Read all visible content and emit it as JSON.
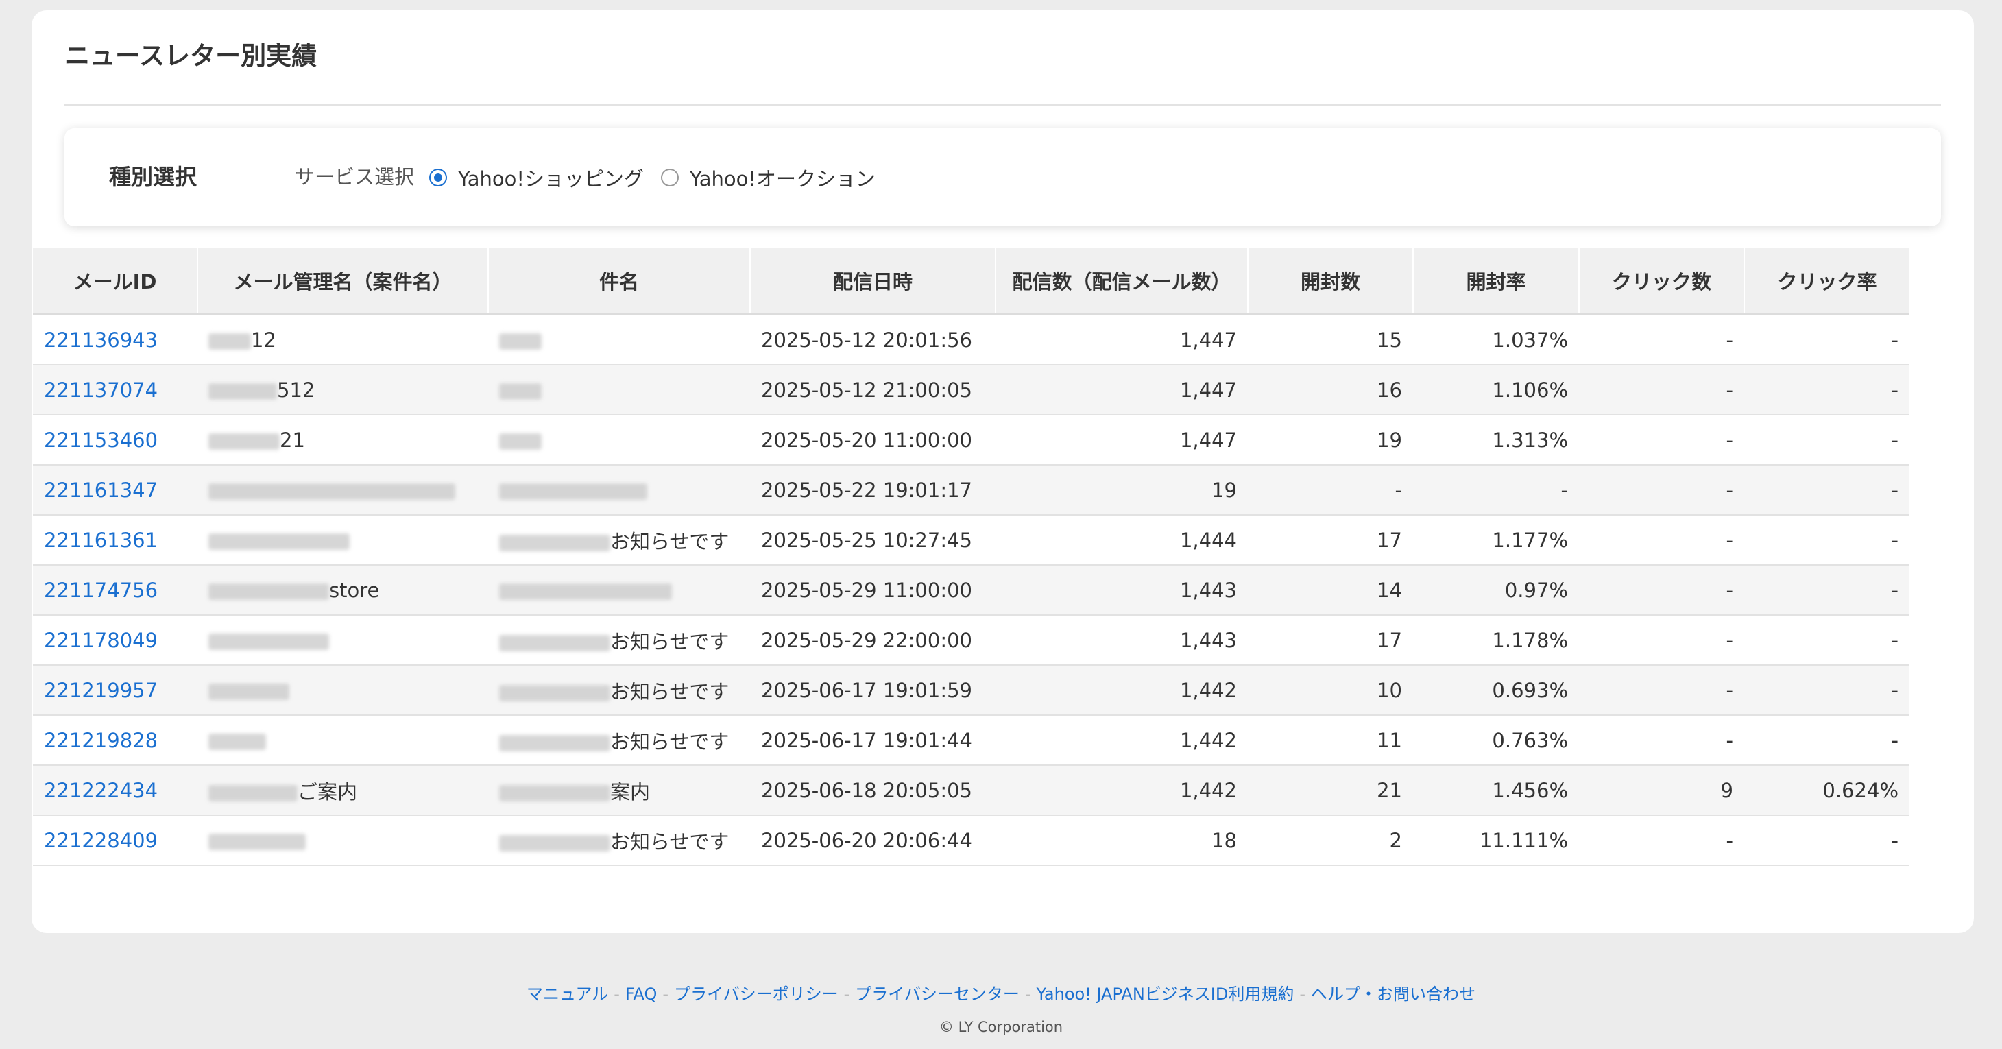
{
  "page": {
    "title": "ニュースレター別実績"
  },
  "filter": {
    "label": "種別選択",
    "service_label": "サービス選択",
    "options": [
      {
        "label": "Yahoo!ショッピング",
        "selected": true
      },
      {
        "label": "Yahoo!オークション",
        "selected": false
      }
    ]
  },
  "table": {
    "headers": [
      "メールID",
      "メール管理名（案件名）",
      "件名",
      "配信日時",
      "配信数（配信メール数）",
      "開封数",
      "開封率",
      "クリック数",
      "クリック率"
    ],
    "rows": [
      {
        "id": "221136943",
        "name_suffix": "12",
        "subject_suffix": "",
        "datetime": "2025-05-12 20:01:56",
        "sent": "1,447",
        "opens": "15",
        "open_rate": "1.037%",
        "clicks": "-",
        "click_rate": "-"
      },
      {
        "id": "221137074",
        "name_suffix": "512",
        "subject_suffix": "",
        "datetime": "2025-05-12 21:00:05",
        "sent": "1,447",
        "opens": "16",
        "open_rate": "1.106%",
        "clicks": "-",
        "click_rate": "-"
      },
      {
        "id": "221153460",
        "name_suffix": "21",
        "subject_suffix": "",
        "datetime": "2025-05-20 11:00:00",
        "sent": "1,447",
        "opens": "19",
        "open_rate": "1.313%",
        "clicks": "-",
        "click_rate": "-"
      },
      {
        "id": "221161347",
        "name_suffix": "",
        "subject_suffix": "",
        "datetime": "2025-05-22 19:01:17",
        "sent": "19",
        "opens": "-",
        "open_rate": "-",
        "clicks": "-",
        "click_rate": "-"
      },
      {
        "id": "221161361",
        "name_suffix": "",
        "subject_suffix": "お知らせです",
        "datetime": "2025-05-25 10:27:45",
        "sent": "1,444",
        "opens": "17",
        "open_rate": "1.177%",
        "clicks": "-",
        "click_rate": "-"
      },
      {
        "id": "221174756",
        "name_suffix": "store",
        "subject_suffix": "",
        "datetime": "2025-05-29 11:00:00",
        "sent": "1,443",
        "opens": "14",
        "open_rate": "0.97%",
        "clicks": "-",
        "click_rate": "-"
      },
      {
        "id": "221178049",
        "name_suffix": "",
        "subject_suffix": "お知らせです",
        "datetime": "2025-05-29 22:00:00",
        "sent": "1,443",
        "opens": "17",
        "open_rate": "1.178%",
        "clicks": "-",
        "click_rate": "-"
      },
      {
        "id": "221219957",
        "name_suffix": "",
        "subject_suffix": "お知らせです",
        "datetime": "2025-06-17 19:01:59",
        "sent": "1,442",
        "opens": "10",
        "open_rate": "0.693%",
        "clicks": "-",
        "click_rate": "-"
      },
      {
        "id": "221219828",
        "name_suffix": "",
        "subject_suffix": "お知らせです",
        "datetime": "2025-06-17 19:01:44",
        "sent": "1,442",
        "opens": "11",
        "open_rate": "0.763%",
        "clicks": "-",
        "click_rate": "-"
      },
      {
        "id": "221222434",
        "name_suffix": "ご案内",
        "subject_suffix": "案内",
        "datetime": "2025-06-18 20:05:05",
        "sent": "1,442",
        "opens": "21",
        "open_rate": "1.456%",
        "clicks": "9",
        "click_rate": "0.624%"
      },
      {
        "id": "221228409",
        "name_suffix": "",
        "subject_suffix": "お知らせです",
        "datetime": "2025-06-20 20:06:44",
        "sent": "18",
        "opens": "2",
        "open_rate": "11.111%",
        "clicks": "-",
        "click_rate": "-"
      }
    ]
  },
  "footer": {
    "links": [
      "マニュアル",
      "FAQ",
      "プライバシーポリシー",
      "プライバシーセンター",
      "Yahoo! JAPANビジネスID利用規約",
      "ヘルプ・お問い合わせ"
    ],
    "copyright": "© LY Corporation"
  },
  "colors": {
    "accent": "#1a6fd0",
    "page_bg": "#ececec",
    "header_bg": "#f0f0f0",
    "stripe": "#f5f5f5"
  }
}
